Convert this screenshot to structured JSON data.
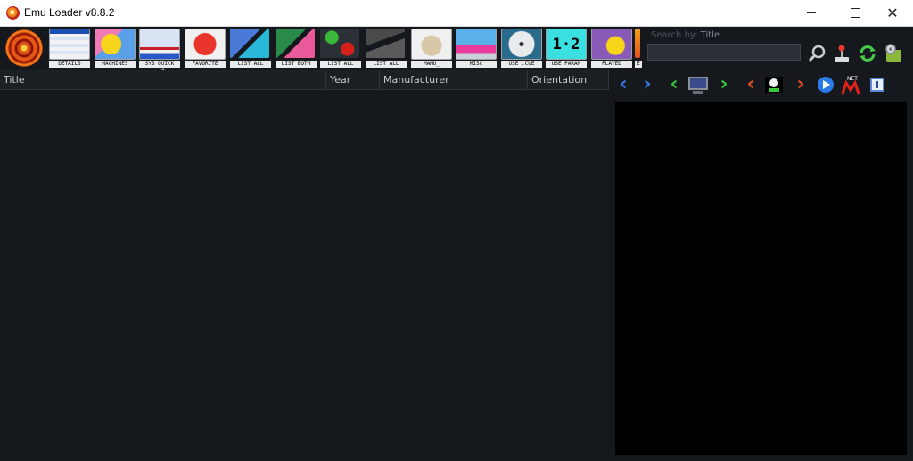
{
  "window": {
    "title": "Emu Loader v8.8.2"
  },
  "toolbar": {
    "buttons": [
      {
        "label": "DETAILS"
      },
      {
        "label": "MACHINES"
      },
      {
        "label": "SYS QUICK"
      },
      {
        "label": "FAVORITE"
      },
      {
        "label": "LIST ALL"
      },
      {
        "label": "LIST BOTH"
      },
      {
        "label": "LIST ALL"
      },
      {
        "label": "LIST ALL"
      },
      {
        "label": "MAMU_"
      },
      {
        "label": "MISC"
      },
      {
        "label": "USE .CUE"
      },
      {
        "label": "USE PARAM"
      },
      {
        "label": "PLAYED"
      },
      {
        "label": "E"
      }
    ],
    "search": {
      "label_prefix": "Search by:",
      "label_field": "Title",
      "value": ""
    }
  },
  "gamelist": {
    "columns": [
      "Title",
      "Year",
      "Manufacturer",
      "Orientation"
    ],
    "sort_indicator": "^"
  },
  "colors": {
    "background": "#14181c",
    "header": "#1b2025",
    "preview": "#000000"
  }
}
